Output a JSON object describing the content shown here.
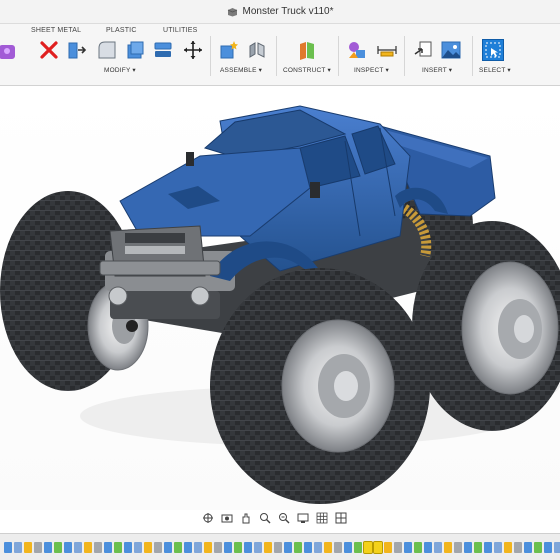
{
  "window": {
    "title": "Monster Truck v110*"
  },
  "ribbon": {
    "tabs": [
      "SHEET METAL",
      "PLASTIC",
      "UTILITIES"
    ],
    "groups": [
      "MODIFY ▾",
      "ASSEMBLE ▾",
      "CONSTRUCT ▾",
      "INSPECT ▾",
      "INSERT ▾",
      "SELECT ▾"
    ]
  },
  "viewport": {
    "model": "monster-truck",
    "body_color": "#2f5fa8",
    "tire_color": "#2f3134"
  },
  "navbar": {
    "tools": [
      "orbit-icon",
      "look-at-icon",
      "pan-icon",
      "zoom-icon",
      "fit-icon",
      "display-settings-icon",
      "grid-icon",
      "viewports-icon"
    ]
  },
  "timeline": {
    "item_count": 64
  }
}
